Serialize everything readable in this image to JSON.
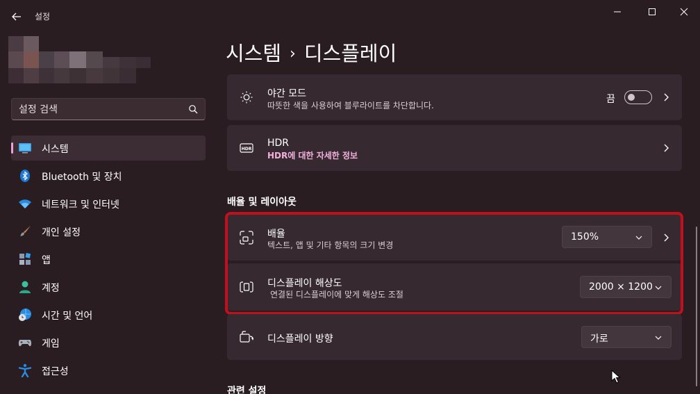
{
  "window": {
    "title": "설정"
  },
  "search": {
    "placeholder": "설정 검색"
  },
  "nav": {
    "items": [
      {
        "label": "시스템",
        "icon": "monitor-icon"
      },
      {
        "label": "Bluetooth 및 장치",
        "icon": "bluetooth-icon"
      },
      {
        "label": "네트워크 및 인터넷",
        "icon": "wifi-icon"
      },
      {
        "label": "개인 설정",
        "icon": "brush-icon"
      },
      {
        "label": "앱",
        "icon": "apps-icon"
      },
      {
        "label": "계정",
        "icon": "person-icon"
      },
      {
        "label": "시간 및 언어",
        "icon": "globe-clock-icon"
      },
      {
        "label": "게임",
        "icon": "gamepad-icon"
      },
      {
        "label": "접근성",
        "icon": "accessibility-icon"
      }
    ]
  },
  "breadcrumb": {
    "parent": "시스템",
    "separator": "›",
    "current": "디스플레이"
  },
  "night_light": {
    "title": "야간 모드",
    "subtitle": "따뜻한 색을 사용하여 블루라이트를 차단합니다.",
    "toggle_label": "끔",
    "toggle_on": false
  },
  "hdr": {
    "title": "HDR",
    "link": "HDR에 대한 자세한 정보"
  },
  "scale_layout": {
    "heading": "배율 및 레이아웃"
  },
  "scale": {
    "title": "배율",
    "subtitle": "텍스트, 앱 및 기타 항목의 크기 변경",
    "value": "150%"
  },
  "resolution": {
    "title": "디스플레이 해상도",
    "subtitle": "연결된 디스플레이에 맞게 해상도 조절",
    "value": "2000 × 1200"
  },
  "orientation": {
    "title": "디스플레이 방향",
    "value": "가로"
  },
  "related": {
    "heading": "관련 설정"
  },
  "colors": {
    "accent": "#f0a0d8",
    "highlight": "#c0101e",
    "background": "#2a1d22",
    "card": "#362a30"
  }
}
